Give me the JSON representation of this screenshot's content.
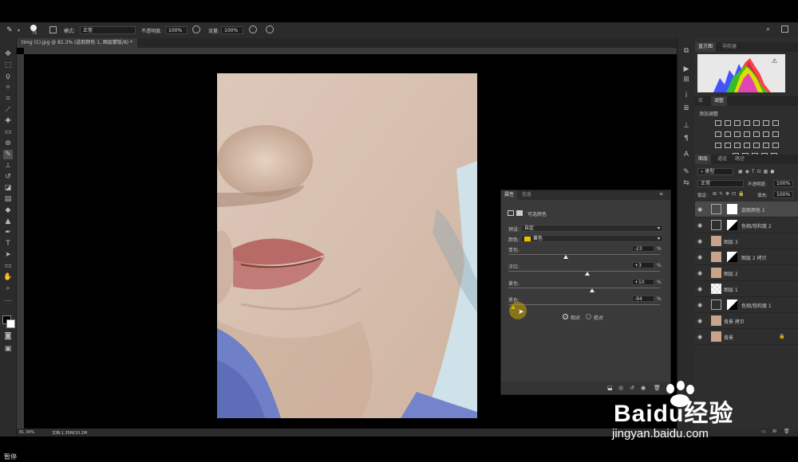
{
  "options_bar": {
    "brush_size": "75",
    "mode_label": "模式:",
    "mode_value": "正常",
    "opacity_label": "不透明度:",
    "opacity_value": "100%",
    "flow_label": "流量:",
    "flow_value": "100%"
  },
  "document": {
    "tab_title": "timg (1).jpg @ 81.3% (选取颜色 1, 图层蒙版/8) *",
    "zoom": "81.34%",
    "doc_info": "文档:1.35M/10.2M"
  },
  "histogram_panel": {
    "tabs": [
      "直方图",
      "导航器"
    ]
  },
  "adjustments_panel": {
    "tabs": [
      "库",
      "调整"
    ],
    "add_label": "添加调整"
  },
  "layers_panel": {
    "tabs": [
      "图层",
      "通道",
      "路径"
    ],
    "kind_filter": "类型",
    "blend_mode": "正常",
    "opacity_label": "不透明度:",
    "opacity_value": "100%",
    "lock_label": "锁定:",
    "fill_label": "填充:",
    "fill_value": "100%",
    "layers": [
      {
        "name": "选取颜色 1",
        "type": "adjustment",
        "selected": true
      },
      {
        "name": "色相/饱和度 2",
        "type": "adjustment",
        "selected": false
      },
      {
        "name": "图层 3",
        "type": "photo",
        "selected": false
      },
      {
        "name": "图层 2 拷贝",
        "type": "photo-mask",
        "selected": false
      },
      {
        "name": "图层 2",
        "type": "photo",
        "selected": false
      },
      {
        "name": "图层 1",
        "type": "transparent",
        "selected": false
      },
      {
        "name": "色相/饱和度 1",
        "type": "adjustment",
        "selected": false
      },
      {
        "name": "背景 拷贝",
        "type": "photo",
        "selected": false
      },
      {
        "name": "背景",
        "type": "photo",
        "selected": false,
        "locked": true
      }
    ]
  },
  "properties_panel": {
    "tabs": [
      "属性",
      "信息"
    ],
    "title": "可选颜色",
    "preset_label": "预设:",
    "preset_value": "自定",
    "colors_label": "颜色:",
    "colors_value": "黄色",
    "sliders": [
      {
        "name": "cyan",
        "label": "青色:",
        "value": "-23",
        "fraction": 0.38
      },
      {
        "name": "magenta",
        "label": "洋红:",
        "value": "+3",
        "fraction": 0.52
      },
      {
        "name": "yellow",
        "label": "黄色:",
        "value": "+10",
        "fraction": 0.55
      },
      {
        "name": "black",
        "label": "黑色:",
        "value": "-94",
        "fraction": 0.03
      }
    ],
    "relative_label": "相对",
    "absolute_label": "绝对",
    "method": "relative"
  },
  "watermark": {
    "brand": "Baidu经验",
    "url": "jingyan.baidu.com"
  },
  "status_caption": "暂停",
  "colors": {
    "ui_bg": "#2b2b2b",
    "panel_bg": "#3a3a3a",
    "yellow_swatch": "#f0c000"
  }
}
